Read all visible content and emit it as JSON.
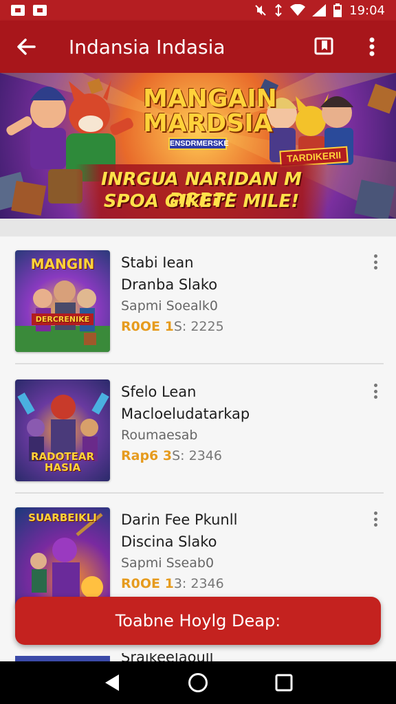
{
  "status_bar": {
    "time": "19:04",
    "left_icons": [
      "app-notification-icon",
      "app-notification-icon"
    ],
    "right_icons": [
      "mute-icon",
      "data-icon",
      "wifi-icon",
      "signal-icon",
      "battery-icon"
    ]
  },
  "app_bar": {
    "title": "Indansia Indasia",
    "back_icon": "arrow-left-icon",
    "actions": [
      "bookmark-icon",
      "more-vert-icon"
    ]
  },
  "banner": {
    "title": "MANGAIN MARDSIA",
    "subtitle": "ENSDRMERSKE",
    "tag": "TARDIKERII",
    "line1": "INRGUA NARIDAN M DORP!",
    "line2": "SPOA GIKETE MILE!"
  },
  "games": [
    {
      "thumb_title": "MANGIN",
      "thumb_caption": "DERCRENIKE",
      "name": "Stabi Iean",
      "subtitle": "Dranba Slako",
      "meta": "Sapmi Soealk0",
      "rate_label": "R0OE 1",
      "rate_value": "S: 2225"
    },
    {
      "thumb_title": "",
      "thumb_caption": "RADOTEAR HASIA",
      "name": "Sfelo Lean",
      "subtitle": "Macloeludatarkap",
      "meta": "Roumaesab",
      "rate_label": "Rap6 3",
      "rate_value": "S: 2346"
    },
    {
      "thumb_title": "SUARBEIKLI",
      "thumb_caption": "",
      "name": "Darin Fee Pkunll",
      "subtitle": "Discina Slako",
      "meta": "Sapmi Sseab0",
      "rate_label": "R0OE 1",
      "rate_value": "3: 2346"
    }
  ],
  "cta": {
    "label": "Toabne Hoylg Deap:"
  },
  "peek_item": {
    "name": "Sraikeelaoull"
  },
  "nav_bar": {
    "buttons": [
      "back-triangle-icon",
      "home-circle-icon",
      "recents-square-icon"
    ]
  },
  "colors": {
    "status_bar": "#b51e22",
    "app_bar": "#a8161b",
    "cta": "#c4221f",
    "rating_highlight": "#e69b1e"
  }
}
